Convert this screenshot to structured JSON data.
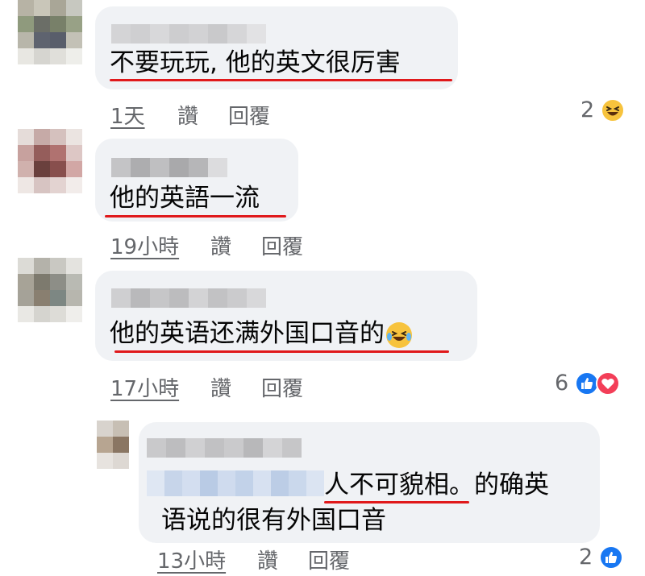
{
  "comments": [
    {
      "text": "不要玩玩, 他的英文很厉害",
      "time": "1天",
      "like": "讚",
      "reply": "回覆",
      "reaction_count": "2",
      "reactions": [
        "haha-icon"
      ]
    },
    {
      "text": "他的英語一流",
      "time": "19小時",
      "like": "讚",
      "reply": "回覆",
      "reaction_count": "",
      "reactions": []
    },
    {
      "text": "他的英语还满外国口音的",
      "time": "17小時",
      "like": "讚",
      "reply": "回覆",
      "reaction_count": "6",
      "reactions": [
        "like-icon",
        "love-icon"
      ]
    }
  ],
  "reply": {
    "text_highlight": "人不可貌相",
    "text_rest": "。的确英",
    "text_line2": "语说的很有外国口音",
    "time": "13小時",
    "like": "讚",
    "reply": "回覆",
    "reaction_count": "2",
    "reactions": [
      "like-icon"
    ]
  },
  "colors": {
    "bubble": "#f0f2f5",
    "underline": "#e0191b",
    "meta": "#65676b",
    "like": "#1877f2",
    "love": "#f33e58",
    "haha": "#f7c33d"
  }
}
